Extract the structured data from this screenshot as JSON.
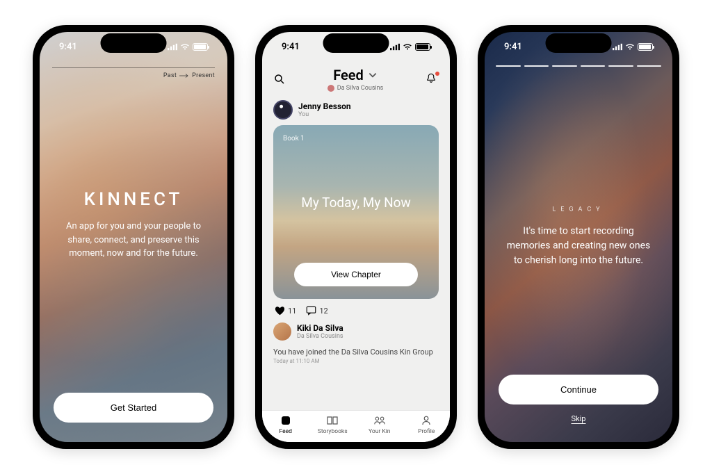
{
  "status": {
    "time": "9:41"
  },
  "screen1": {
    "pastpresent_left": "Past",
    "pastpresent_right": "Present",
    "title": "KINNECT",
    "subtitle": "An app for you and your people to share, connect, and preserve this moment, now and for the future.",
    "cta": "Get Started"
  },
  "screen2": {
    "header_title": "Feed",
    "header_group": "Da Silva Cousins",
    "post1": {
      "author": "Jenny Besson",
      "relation": "You",
      "book_label": "Book 1",
      "card_title": "My Today, My Now",
      "card_cta": "View Chapter",
      "likes": "11",
      "comments": "12"
    },
    "post2": {
      "author": "Kiki Da Silva",
      "group": "Da Silva Cousins",
      "joined_text": "You have joined the Da Silva Cousins Kin Group",
      "timestamp": "Today at 11:10 AM"
    },
    "tabs": {
      "feed": "Feed",
      "storybooks": "Storybooks",
      "kin": "Your Kin",
      "profile": "Profile"
    }
  },
  "screen3": {
    "eyebrow": "LEGACY",
    "body": "It's time to start recording memories and creating new ones to cherish long into the future.",
    "cta": "Continue",
    "skip": "Skip"
  }
}
